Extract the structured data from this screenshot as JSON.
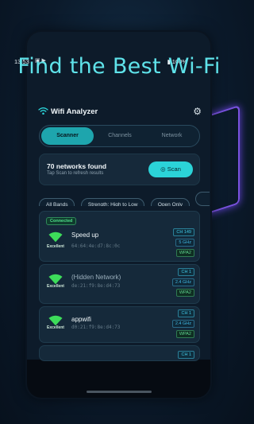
{
  "promo": {
    "headline": "Find the Best Wi-Fi"
  },
  "status_bar": {
    "time": "13:53",
    "icons": "▣ ▶",
    "battery": "▮ 100%"
  },
  "app": {
    "title": "Wifi Analyzer",
    "settings_icon": "gear-icon"
  },
  "tabs": [
    {
      "label": "Scanner",
      "active": true
    },
    {
      "label": "Channels",
      "active": false
    },
    {
      "label": "Network",
      "active": false
    }
  ],
  "summary": {
    "count_text": "70 networks found",
    "hint": "Tap Scan to refresh results",
    "scan_label": "Scan",
    "scan_icon": "◎"
  },
  "filters": [
    "All Bands",
    "Strength: High to Low",
    "Open Only",
    ""
  ],
  "networks": [
    {
      "connected_label": "Connected",
      "ssid": "Speed up",
      "mac": "64:64:4e:d7:8c:0c",
      "signal": "Excellent",
      "channel": "CH 149",
      "band": "5 GHz",
      "security": "WPA2"
    },
    {
      "ssid": "(Hidden Network)",
      "mac": "de:21:f9:8e:d4:73",
      "signal": "Excellent",
      "channel": "CH 1",
      "band": "2.4 GHz",
      "security": "WPA2"
    },
    {
      "ssid": "appwifi",
      "mac": "d0:21:f9:8e:d4:73",
      "signal": "Excellent",
      "channel": "CH 1",
      "band": "2.4 GHz",
      "security": "WPA2"
    },
    {
      "channel": "CH 1"
    }
  ],
  "colors": {
    "accent": "#2bd3d8",
    "signal_green": "#3ddc5a",
    "promo_text": "#5fe3ea",
    "background": "#0d1b2a"
  }
}
